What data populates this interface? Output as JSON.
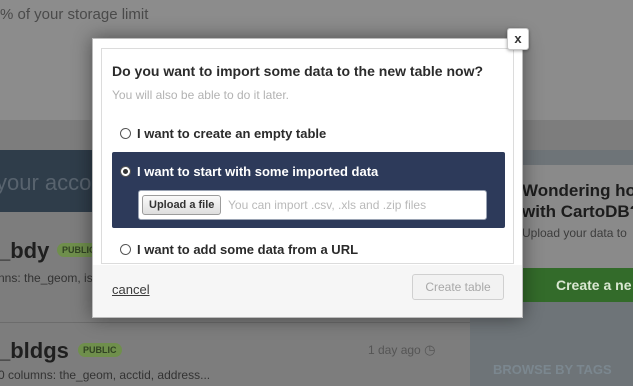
{
  "background": {
    "storage_text": "% of your storage limit",
    "account_text": "your acco",
    "sidebar": {
      "heading": "Wondering ho\nwith CartoDB?",
      "upload_text": "Upload your data to",
      "create_button": "Create a ne",
      "browse_tags": "BROWSE BY TAGS"
    },
    "tables": [
      {
        "name": "_bdy",
        "badge": "PUBLIC",
        "columns": "nns: the_geom, isocode..."
      },
      {
        "name": "_bldgs",
        "badge": "PUBLIC",
        "columns": "0 columns: the_geom, acctid, address...",
        "time": "1 day ago"
      }
    ]
  },
  "modal": {
    "close_label": "x",
    "title": "Do you want to import some data to the new table now?",
    "subtitle": "You will also be able to do it later.",
    "options": [
      {
        "label": "I want to create an empty table",
        "selected": false
      },
      {
        "label": "I want to start with some imported data",
        "selected": true
      },
      {
        "label": "I want to add some data from a URL",
        "selected": false
      }
    ],
    "upload": {
      "button_label": "Upload a file",
      "hint": "You can import .csv, .xls and .zip files"
    },
    "cancel_label": "cancel",
    "create_label": "Create table"
  },
  "colors": {
    "selected_option_bg": "#2d3a5a",
    "overlay": "#7d7d7d"
  },
  "icons": {
    "close": "close-icon",
    "clock": "clock-icon",
    "radio": "radio-icon"
  }
}
